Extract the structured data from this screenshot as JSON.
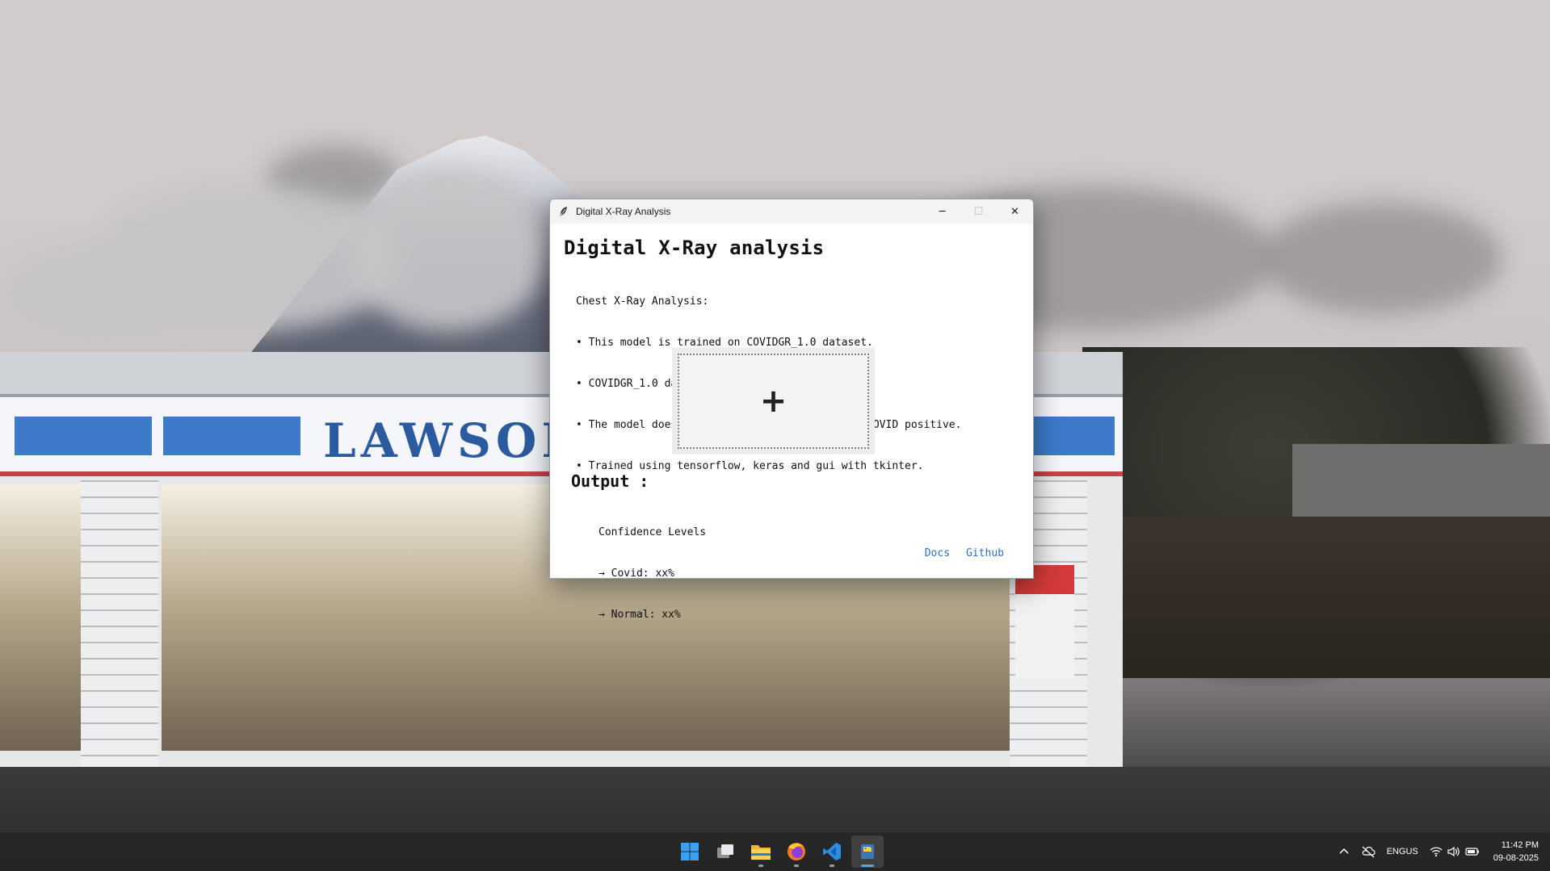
{
  "window": {
    "title": "Digital X-Ray Analysis",
    "app_icon": "feather-icon",
    "controls": {
      "minimize": "─",
      "maximize": "☐",
      "close": "✕"
    }
  },
  "app": {
    "heading": "Digital X-Ray analysis",
    "description": [
      "Chest X-Ray Analysis:",
      "• This model is trained on COVIDGR_1.0 dataset.",
      "• COVIDGR_1.0 dataset is publically available .",
      "• The model does binary prediction: Normal or COVID positive.",
      "• Trained using tensorflow, keras and gui with tkinter."
    ],
    "upload_symbol": "+",
    "output_label": "Output :",
    "confidence": {
      "title": "Confidence Levels",
      "covid": "→ Covid: xx%",
      "normal": "→ Normal: xx%"
    },
    "links": {
      "docs": "Docs",
      "github": "Github"
    },
    "colors": {
      "link": "#2b73c6"
    }
  },
  "wallpaper": {
    "store_sign": "LAWSON"
  },
  "taskbar": {
    "apps": [
      {
        "name": "start-button",
        "icon": "windows-logo-icon"
      },
      {
        "name": "task-view-button",
        "icon": "task-view-icon"
      },
      {
        "name": "file-explorer-button",
        "icon": "folder-icon"
      },
      {
        "name": "firefox-button",
        "icon": "firefox-icon"
      },
      {
        "name": "vscode-button",
        "icon": "vscode-icon"
      },
      {
        "name": "python-app-button",
        "icon": "python-icon"
      }
    ],
    "tray": {
      "language_top": "ENG",
      "language_bottom": "US",
      "time": "11:42 PM",
      "date": "09-08-2025"
    }
  }
}
